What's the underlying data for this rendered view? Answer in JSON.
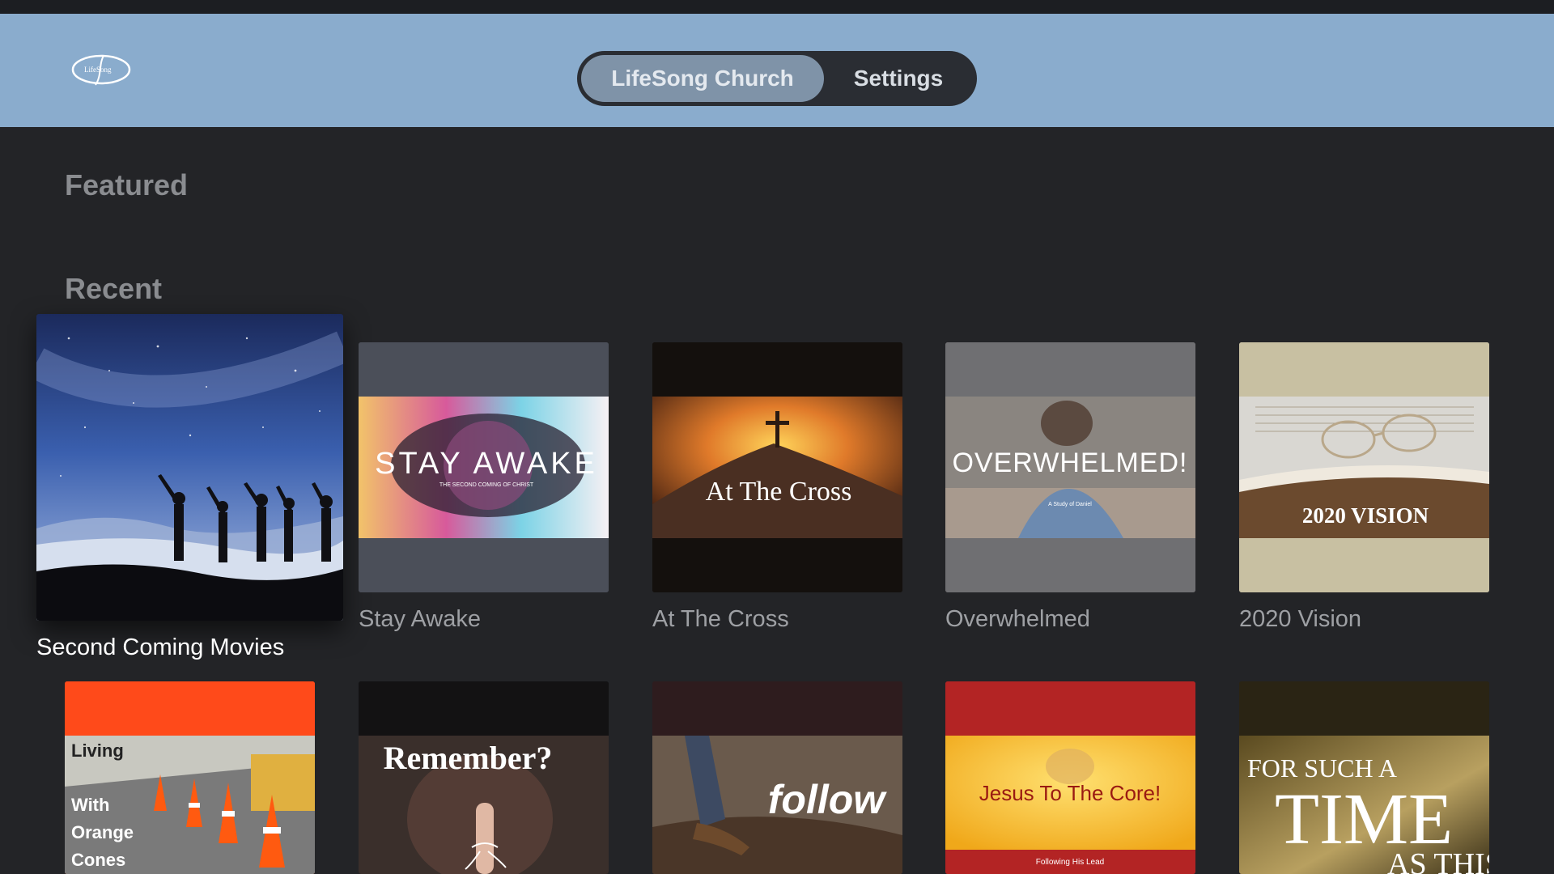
{
  "header": {
    "logo_text": "LifeSong",
    "tabs": [
      {
        "label": "LifeSong Church",
        "active": true
      },
      {
        "label": "Settings",
        "active": false
      }
    ]
  },
  "sections": {
    "featured": {
      "title": "Featured"
    },
    "recent": {
      "title": "Recent"
    }
  },
  "recent_row1": [
    {
      "title": "Second Coming Movies",
      "focused": true,
      "icon": "silhouettes-night-sky"
    },
    {
      "title": "Stay Awake",
      "art_text": "STAY AWAKE",
      "art_subtext": "THE SECOND COMING OF CHRIST",
      "icon": "eye-artwork"
    },
    {
      "title": "At The Cross",
      "art_text": "At The Cross",
      "icon": "cross-on-hill-artwork"
    },
    {
      "title": "Overwhelmed",
      "art_text": "OVERWHELMED!",
      "art_subtext": "A Study of Daniel",
      "icon": "man-head-in-hands-artwork"
    },
    {
      "title": "2020 Vision",
      "art_text": "2020 VISION",
      "icon": "glasses-on-bible-artwork"
    }
  ],
  "recent_row2": [
    {
      "art_lines": [
        "Living",
        "With",
        "Orange",
        "Cones"
      ],
      "icon": "traffic-cones-artwork"
    },
    {
      "art_text": "Remember?",
      "icon": "string-on-finger-artwork"
    },
    {
      "art_text": "follow",
      "icon": "walking-feet-artwork"
    },
    {
      "art_text": "Jesus To The Core!",
      "art_subtext": "Following His Lead",
      "icon": "apple-core-artwork"
    },
    {
      "art_lines": [
        "FOR SUCH A",
        "TIME",
        "AS THIS"
      ],
      "icon": "time-artwork"
    }
  ],
  "colors": {
    "background": "#232427",
    "header": "#8aaccd",
    "tab_bar": "#2a2d33",
    "tab_active": "#7f93a8"
  }
}
